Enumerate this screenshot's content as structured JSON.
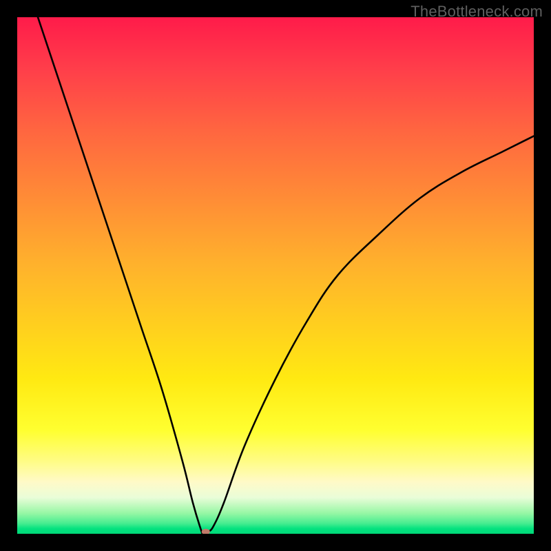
{
  "watermark": "TheBottleneck.com",
  "chart_data": {
    "type": "line",
    "title": "",
    "xlabel": "",
    "ylabel": "",
    "xlim": [
      0,
      100
    ],
    "ylim": [
      0,
      100
    ],
    "dip_x": 36,
    "left_start": {
      "x": 4,
      "y": 100
    },
    "right_end": {
      "x": 100,
      "y": 77
    },
    "series": [
      {
        "name": "bottleneck-curve",
        "x": [
          4,
          8,
          12,
          16,
          20,
          24,
          28,
          32,
          34,
          35.5,
          36,
          37,
          38,
          40,
          44,
          50,
          56,
          62,
          70,
          78,
          86,
          94,
          100
        ],
        "y": [
          100,
          88,
          76,
          64,
          52,
          40,
          28,
          14,
          6,
          1,
          0,
          0.4,
          1.5,
          6,
          17,
          30,
          41,
          50,
          58,
          65,
          70,
          74,
          77
        ]
      }
    ],
    "marker": {
      "x": 36.5,
      "y": 0.4,
      "color": "#c07a6a",
      "rx": 6,
      "ry": 4.3
    },
    "gradient_stops": [
      {
        "pos": 0,
        "color": "#ff1b4a"
      },
      {
        "pos": 50,
        "color": "#ffd01e"
      },
      {
        "pos": 80,
        "color": "#ffff30"
      },
      {
        "pos": 100,
        "color": "#00d878"
      }
    ]
  }
}
